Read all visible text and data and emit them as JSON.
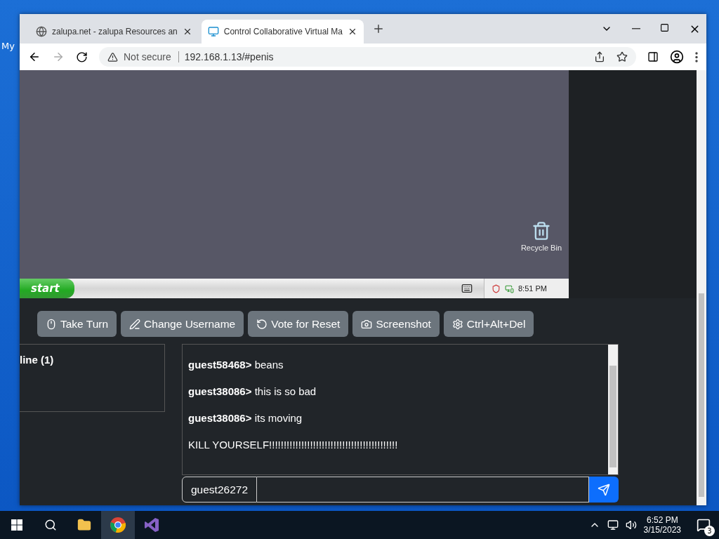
{
  "desktop": {
    "icons": [
      {
        "label": "My"
      }
    ]
  },
  "browser": {
    "tabs": [
      {
        "title": "zalupa.net - zalupa Resources an",
        "selected": false
      },
      {
        "title": "Control Collaborative Virtual Ma",
        "selected": true
      }
    ],
    "address": {
      "security": "Not secure",
      "url": "192.168.1.13/#penis"
    }
  },
  "vm_screen": {
    "icons": [
      {
        "label": "Recycle Bin"
      }
    ],
    "start_label": "start",
    "clock": "8:51 PM"
  },
  "controls": [
    {
      "label": "Take Turn"
    },
    {
      "label": "Change Username"
    },
    {
      "label": "Vote for Reset"
    },
    {
      "label": "Screenshot"
    },
    {
      "label": "Ctrl+Alt+Del"
    }
  ],
  "users_panel": {
    "title": "line (1)"
  },
  "chat": {
    "messages": [
      {
        "user": "guest58468>",
        "text": "beans"
      },
      {
        "user": "guest38086>",
        "text": "this is so bad"
      },
      {
        "user": "guest38086>",
        "text": "its moving"
      },
      {
        "text": "KILL YOURSELF!!!!!!!!!!!!!!!!!!!!!!!!!!!!!!!!!!!!!!!!!!!!"
      }
    ],
    "username": "guest26272"
  },
  "taskbar": {
    "time": "6:52 PM",
    "date": "3/15/2023",
    "notifications": "3"
  }
}
